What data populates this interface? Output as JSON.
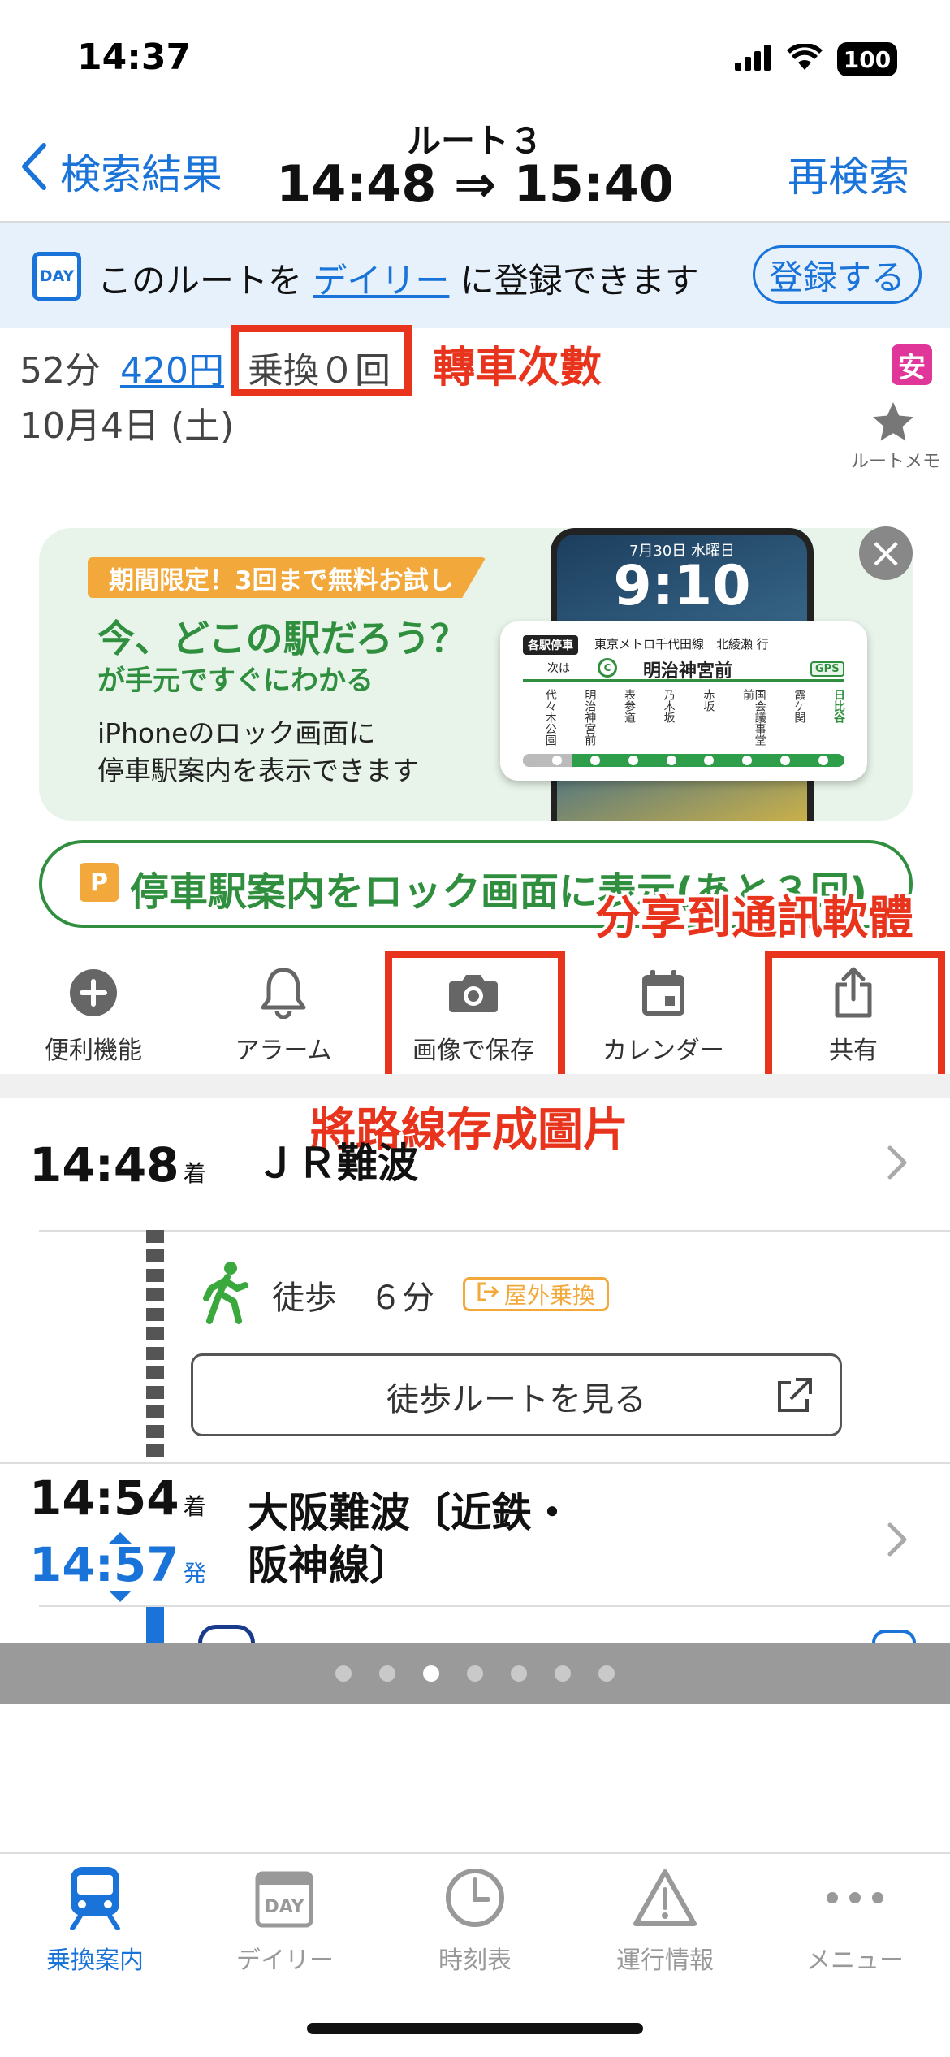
{
  "status_bar": {
    "time": "14:37",
    "battery": "100"
  },
  "header": {
    "back_label": "検索結果",
    "title": "ルート３",
    "times": "14:48 ⇒ 15:40",
    "research_label": "再検索"
  },
  "daily_banner": {
    "icon_text": "DAY",
    "text_before": "このルートを",
    "link": "デイリー",
    "text_after": "に登録できます",
    "register_label": "登録する"
  },
  "summary": {
    "duration": "52分",
    "fare": "420円",
    "transfers": "乗換０回",
    "date": "10月4日 (土)",
    "safe_badge": "安",
    "memo_label": "ルートメモ"
  },
  "promo": {
    "tag": "期間限定！3回まで無料お試し",
    "headline": "今、どこの駅だろう？",
    "subhead": "が手元ですぐにわかる",
    "body_line1": "iPhoneのロック画面に",
    "body_line2": "停車駅案内を表示できます",
    "phone_date": "7月30日 水曜日",
    "phone_time": "9:10",
    "card_tag": "各駅停車",
    "card_line": "東京メトロ千代田線　北綾瀬 行",
    "card_next": "次は",
    "card_line_symbol": "C",
    "card_station": "明治神宮前",
    "card_gps": "GPS",
    "stops": [
      "代々木公園",
      "明治神宮前",
      "表参道",
      "乃木坂",
      "赤坂",
      "国会議事堂前",
      "霞ケ関",
      "日比谷"
    ],
    "close_symbol": "×"
  },
  "lock_button": {
    "icon_text": "P",
    "label": "停車駅案内をロック画面に表示(あと３回)"
  },
  "actions": [
    {
      "label": "便利機能"
    },
    {
      "label": "アラーム"
    },
    {
      "label": "画像で保存"
    },
    {
      "label": "カレンダー"
    },
    {
      "label": "共有"
    }
  ],
  "annotations": {
    "transfers": "轉車次數",
    "share": "分享到通訊軟體",
    "save_image": "將路線存成圖片"
  },
  "route": {
    "first": {
      "time": "14:48",
      "suffix": "着",
      "station": "ＪＲ難波"
    },
    "walk": {
      "label": "徒歩　６分",
      "badge": "屋外乗換",
      "button": "徒歩ルートを見る"
    },
    "second": {
      "arrive": "14:54",
      "arrive_suffix": "着",
      "depart": "14:57",
      "depart_suffix": "発",
      "station_line1": "大阪難波〔近鉄・",
      "station_line2": "阪神線〕"
    }
  },
  "pager": {
    "count": 7,
    "active_index": 2
  },
  "tabs": [
    {
      "label": "乗換案内",
      "active": true
    },
    {
      "label": "デイリー",
      "active": false
    },
    {
      "label": "時刻表",
      "active": false
    },
    {
      "label": "運行情報",
      "active": false
    },
    {
      "label": "メニュー",
      "active": false
    }
  ],
  "colors": {
    "accent": "#1a73d9",
    "green": "#2f8f3e",
    "annotation": "#e8341c",
    "orange": "#f2a83b"
  }
}
